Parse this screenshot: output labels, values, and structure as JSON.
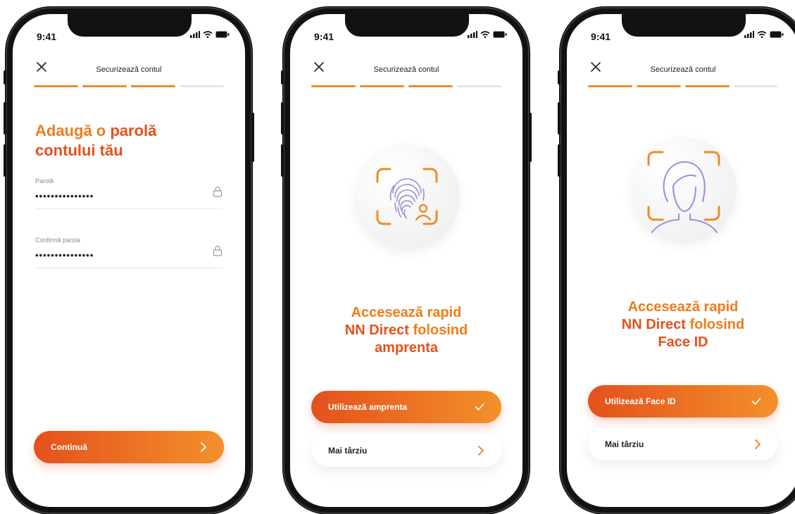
{
  "status_time": "9:41",
  "screen_title": "Securizează contul",
  "progress_steps": 4,
  "progress_done": 3,
  "password_screen": {
    "heading_line1_part1": "Adaugă o ",
    "heading_line1_part2": "parolă",
    "heading_line2": "contului tău",
    "password_label": "Parolă",
    "password_value": "•••••••••••••••",
    "confirm_label": "Confirmă parola",
    "confirm_value": "•••••••••••••••",
    "continue_label": "Continuă"
  },
  "fingerprint_screen": {
    "line1": "Accesează rapid",
    "line2_part1": "NN Direct ",
    "line2_part2": "folosind",
    "line3": "amprenta",
    "primary_label": "Utilizează amprenta",
    "secondary_label": "Mai târziu"
  },
  "faceid_screen": {
    "line1": "Accesează rapid",
    "line2_part1": "NN Direct ",
    "line2_part2": "folosind",
    "line3": "Face ID",
    "primary_label": "Utilizează Face ID",
    "secondary_label": "Mai târziu"
  },
  "colors": {
    "brand_orange": "#f07b1a",
    "brand_red": "#e4511d",
    "accent_purple": "#9b8ed6"
  }
}
